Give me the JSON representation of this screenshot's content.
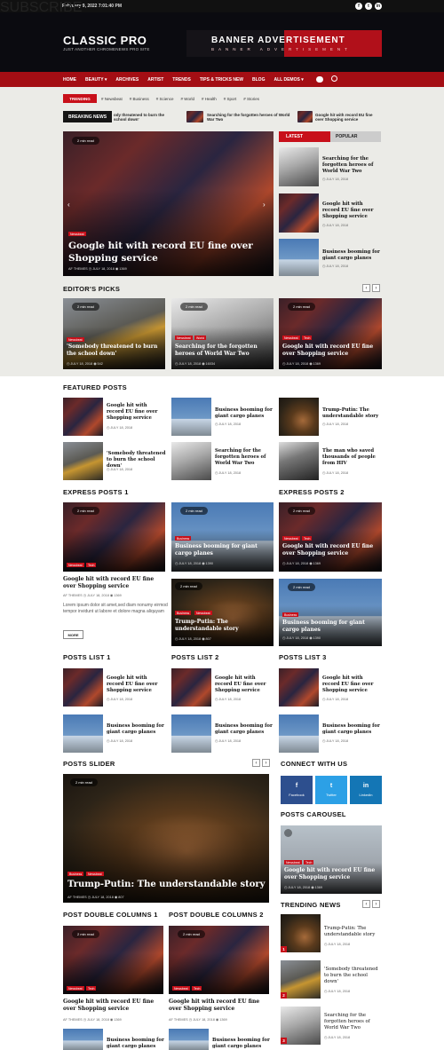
{
  "topbar": {
    "date": "February 9, 2022 7:01:40 PM",
    "social": [
      "f",
      "t",
      "in"
    ]
  },
  "header": {
    "logo": "CLASSIC PRO",
    "tagline": "JUST ANOTHER CHROMENEWS PRO SITE",
    "banner_title": "BANNER ADVERTISEMENT",
    "banner_sub": "BANNER ADVERTISEMENT"
  },
  "nav": {
    "items": [
      "HOME",
      "BEAUTY ▾",
      "ARCHIVES",
      "ARTIST",
      "TRENDS",
      "TIPS & TRICKS NEW",
      "BLOG",
      "ALL DEMOS ▾"
    ],
    "subscribe": "SUBSCRIBE"
  },
  "trending": {
    "label": "TRENDING",
    "tags": [
      "# Newsbeat",
      "# Business",
      "# Science",
      "# World",
      "# Health",
      "# Sport",
      "# Stories"
    ]
  },
  "breaking": {
    "label": "BREAKING NEWS",
    "items": [
      "ody threatened to burn the school down'",
      "Searching for the forgotten heroes of World War Two",
      "Google hit with record EU fine over Shopping service"
    ]
  },
  "hero": {
    "read": "2 min read",
    "cat": "Newsbeat",
    "title": "Google hit with record EU fine over Shopping service",
    "meta": "AF THEMES  ◷ JULY 18, 2018  ◉ 1369"
  },
  "tabs": {
    "latest": "LATEST",
    "popular": "POPULAR",
    "items": [
      {
        "title": "Searching for the forgotten heroes of World War Two",
        "date": "◷ JULY 18, 2018"
      },
      {
        "title": "Google hit with record EU fine over Shopping service",
        "date": "◷ JULY 18, 2018"
      },
      {
        "title": "Business booming for giant cargo planes",
        "date": "◷ JULY 18, 2018"
      }
    ]
  },
  "editors": {
    "title": "EDITOR'S PICKS",
    "cards": [
      {
        "read": "2 min read",
        "cats": [
          "Newsbeat"
        ],
        "title": "'Somebody threatened to burn the school down'",
        "meta": "◷ JULY 18, 2018  ◉ 542"
      },
      {
        "read": "2 min read",
        "cats": [
          "Newsbeat",
          "World"
        ],
        "title": "Searching for the forgotten heroes of World War Two",
        "meta": "◷ JULY 18, 2018  ◉ 16034"
      },
      {
        "read": "2 min read",
        "cats": [
          "Newsbeat",
          "Tech"
        ],
        "title": "Google hit with record EU fine over Shopping service",
        "meta": "◷ JULY 18, 2018  ◉ 1369"
      }
    ]
  },
  "featured": {
    "title": "FEATURED POSTS",
    "items": [
      {
        "title": "Google hit with record EU fine over Shopping service",
        "date": "◷ JULY 18, 2018"
      },
      {
        "title": "Business booming for giant cargo planes",
        "date": "◷ JULY 18, 2018"
      },
      {
        "title": "Trump-Putin: The understandable story",
        "date": "◷ JULY 18, 2018"
      },
      {
        "title": "'Somebody threatened to burn the school down'",
        "date": "◷ JULY 18, 2018"
      },
      {
        "title": "Searching for the forgotten heroes of World War Two",
        "date": "◷ JULY 18, 2018"
      },
      {
        "title": "The man who saved thousands of people from HIV",
        "date": "◷ JULY 18, 2018"
      }
    ]
  },
  "express1": {
    "title": "EXPRESS POSTS 1",
    "read": "2 min read",
    "cats": [
      "Newsbeat",
      "Tech"
    ],
    "post_title": "Google hit with record EU fine over Shopping service",
    "meta": "AF THEMES  ◷ JULY 18, 2018  ◉ 1369",
    "excerpt": "Lorem ipsum dolor sit amet,sed diam nonumy eirmod tempor invidunt ut labore et dolore magna aliquyam",
    "more": "MORE"
  },
  "middle": {
    "cards": [
      {
        "read": "2 min read",
        "cats": [
          "Business"
        ],
        "title": "Business booming for giant cargo planes",
        "meta": "◷ JULY 18, 2018  ◉ 1390"
      },
      {
        "read": "2 min read",
        "cats": [
          "Business",
          "Newsbeat"
        ],
        "title": "Trump-Putin: The understandable story",
        "meta": "◷ JULY 18, 2018  ◉ 807"
      }
    ]
  },
  "express2": {
    "title": "EXPRESS POSTS 2",
    "cards": [
      {
        "read": "2 min read",
        "cats": [
          "Newsbeat",
          "Tech"
        ],
        "title": "Google hit with record EU fine over Shopping service",
        "meta": "◷ JULY 18, 2018  ◉ 1369"
      },
      {
        "read": "2 min read",
        "cats": [
          "Business"
        ],
        "title": "Business booming for giant cargo planes",
        "meta": "◷ JULY 18, 2018  ◉ 1390"
      }
    ]
  },
  "lists": [
    {
      "title": "POSTS LIST 1",
      "items": [
        {
          "title": "Google hit with record EU fine over Shopping service",
          "date": "◷ JULY 18, 2018"
        },
        {
          "title": "Business booming for giant cargo planes",
          "date": "◷ JULY 18, 2018"
        }
      ]
    },
    {
      "title": "POSTS LIST 2",
      "items": [
        {
          "title": "Google hit with record EU fine over Shopping service",
          "date": "◷ JULY 18, 2018"
        },
        {
          "title": "Business booming for giant cargo planes",
          "date": "◷ JULY 18, 2018"
        }
      ]
    },
    {
      "title": "POSTS LIST 3",
      "items": [
        {
          "title": "Google hit with record EU fine over Shopping service",
          "date": "◷ JULY 18, 2018"
        },
        {
          "title": "Business booming for giant cargo planes",
          "date": "◷ JULY 18, 2018"
        }
      ]
    }
  ],
  "slider": {
    "title": "POSTS SLIDER",
    "read": "2 min read",
    "cats": [
      "Business",
      "Newsbeat"
    ],
    "post_title": "Trump-Putin: The understandable story",
    "meta": "AF THEMES  ◷ JULY 18, 2018  ◉ 807"
  },
  "connect": {
    "title": "CONNECT WITH US",
    "items": [
      {
        "icon": "f",
        "label": "Facebook",
        "color": "#2d4f8e"
      },
      {
        "icon": "t",
        "label": "Twitter",
        "color": "#2ca0e6"
      },
      {
        "icon": "in",
        "label": "Linkedin",
        "color": "#1476b5"
      }
    ]
  },
  "carousel": {
    "title": "POSTS CAROUSEL",
    "cats": [
      "Newsbeat",
      "Tech"
    ],
    "post_title": "Google hit with record EU fine over Shopping service",
    "meta": "◷ JULY 18, 2018  ◉ 1369"
  },
  "double": {
    "titles": [
      "POST DOUBLE COLUMNS 1",
      "POST DOUBLE COLUMNS 2"
    ],
    "read": "2 min read",
    "cats": [
      "Newsbeat",
      "Tech"
    ],
    "post_title": "Google hit with record EU fine over Shopping service",
    "meta": "AF THEMES  ◷ JULY 18, 2018  ◉ 1369",
    "item_title": "Business booming for giant cargo planes",
    "item_date": "◷ JULY 18, 2018"
  },
  "trending_news": {
    "title": "TRENDING NEWS",
    "items": [
      {
        "rank": "1",
        "title": "Trump-Putin: The understandable story",
        "date": "◷ JULY 18, 2018"
      },
      {
        "rank": "2",
        "title": "'Somebody threatened to burn the school down'",
        "date": "◷ JULY 18, 2018"
      },
      {
        "rank": "3",
        "title": "Searching for the forgotten heroes of World War Two",
        "date": "◷ JULY 18, 2018"
      }
    ]
  },
  "arrow_prev": "‹",
  "arrow_next": "›"
}
